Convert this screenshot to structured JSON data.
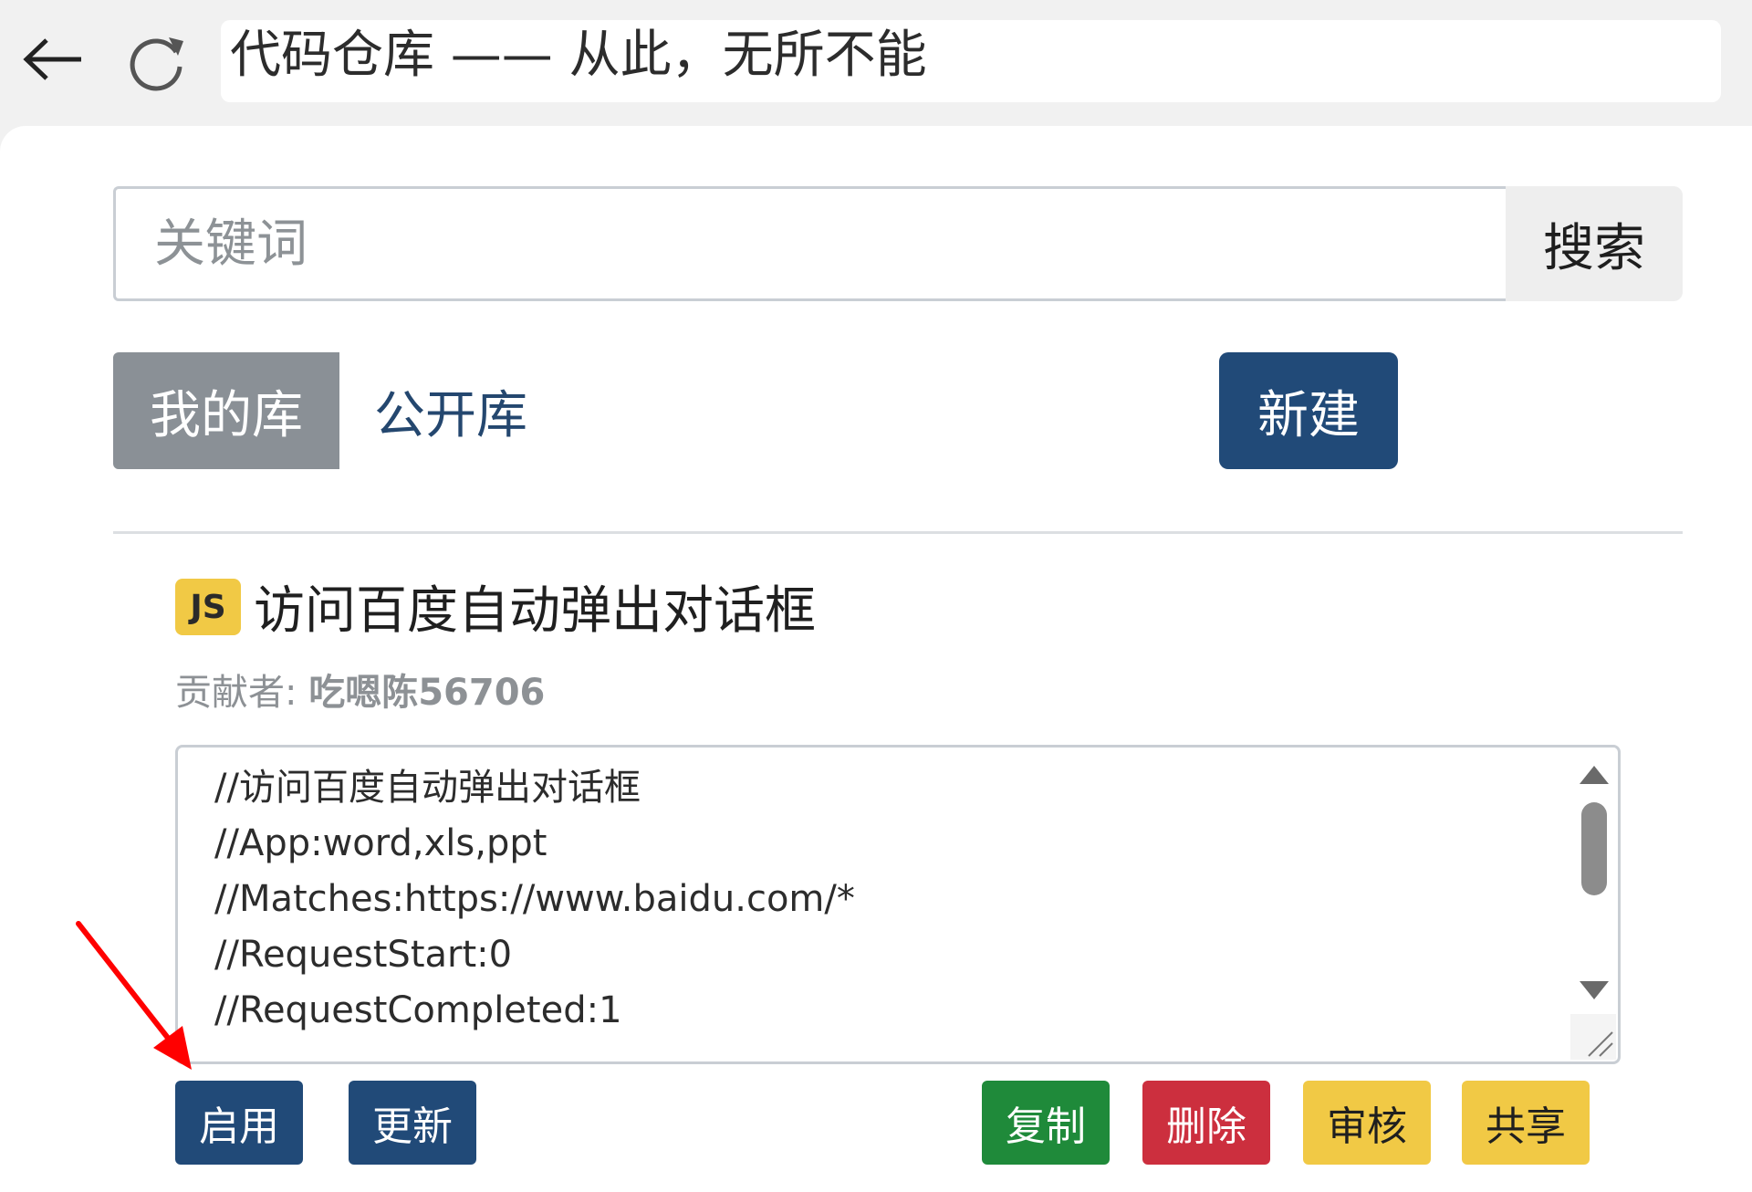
{
  "browser": {
    "address_text": "代码仓库 —— 从此，无所不能",
    "back_icon": "back-arrow-icon",
    "reload_icon": "reload-icon"
  },
  "search": {
    "placeholder": "关键词",
    "button_label": "搜索"
  },
  "tabs": [
    {
      "label": "我的库",
      "active": true
    },
    {
      "label": "公开库",
      "active": false
    }
  ],
  "new_button_label": "新建",
  "item": {
    "badge": "JS",
    "title": "访问百度自动弹出对话框",
    "contributor_label": "贡献者:",
    "contributor_name": "吃嗯陈56706",
    "code_lines": [
      "//访问百度自动弹出对话框",
      "//App:word,xls,ppt",
      "//Matches:https://www.baidu.com/*",
      "//RequestStart:0",
      "//RequestCompleted:1"
    ],
    "actions": {
      "enable": "启用",
      "update": "更新",
      "copy": "复制",
      "delete": "删除",
      "review": "审核",
      "share": "共享"
    }
  },
  "colors": {
    "primary": "#214a78",
    "success": "#1f8a3a",
    "danger": "#cc2f3e",
    "warning": "#f1c945",
    "tab_active": "#8a9096",
    "annotation": "#ff0000"
  }
}
